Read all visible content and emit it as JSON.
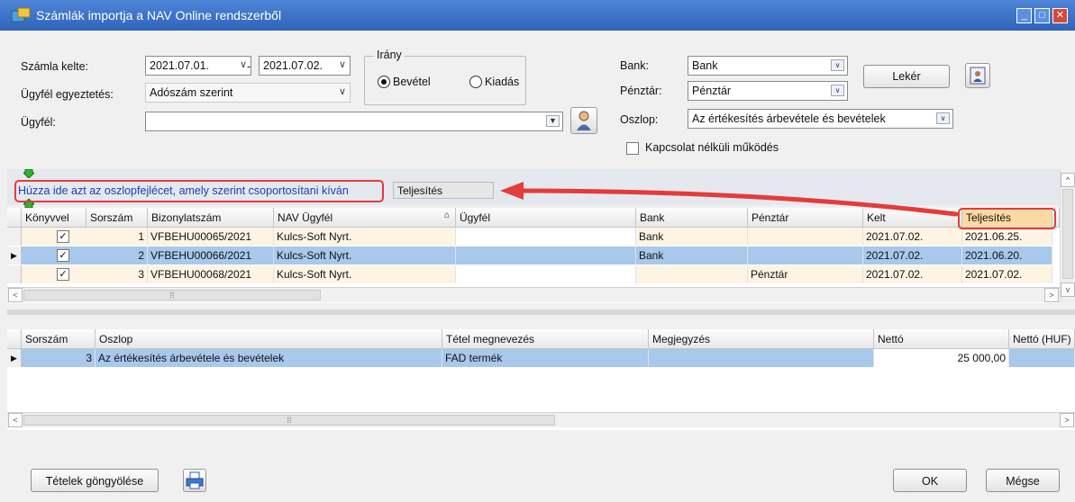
{
  "window": {
    "title": "Számlák importja a NAV Online rendszerből",
    "controls": [
      "minimize-icon",
      "maximize-icon",
      "close-icon"
    ]
  },
  "filters": {
    "invoice_date_label": "Számla kelte:",
    "date_from": "2021.07.01.",
    "date_sep": "-",
    "date_to": "2021.07.02.",
    "client_match_label": "Ügyfél egyeztetés:",
    "client_match_value": "Adószám szerint",
    "client_label": "Ügyfél:",
    "client_value": "",
    "direction_legend": "Irány",
    "direction_income": "Bevétel",
    "direction_expense": "Kiadás",
    "direction_selected": "Bevétel",
    "bank_label": "Bank:",
    "bank_value": "Bank",
    "cash_label": "Pénztár:",
    "cash_value": "Pénztár",
    "column_label": "Oszlop:",
    "column_value": "Az értékesítés árbevétele és bevételek",
    "offline_label": "Kapcsolat nélküli működés",
    "offline_checked": false,
    "fetch_button": "Lekér"
  },
  "grouping": {
    "hint": "Húzza ide azt az oszlopfejlécet, amely szerint csoportosítani kíván",
    "dragged_column": "Teljesítés"
  },
  "invoices_grid": {
    "columns": [
      "Könyvvel",
      "Sorszám",
      "Bizonylatszám",
      "NAV Ügyfél",
      "Ügyfél",
      "Bank",
      "Pénztár",
      "Kelt",
      "Teljesítés"
    ],
    "rows": [
      {
        "checked": true,
        "no": "1",
        "doc": "VFBEHU00065/2021",
        "nav_client": "Kulcs-Soft Nyrt.",
        "client": "",
        "bank": "Bank",
        "cash": "",
        "date": "2021.07.02.",
        "fulfil": "2021.06.25.",
        "selected": false
      },
      {
        "checked": true,
        "no": "2",
        "doc": "VFBEHU00066/2021",
        "nav_client": "Kulcs-Soft Nyrt.",
        "client": "",
        "bank": "Bank",
        "cash": "",
        "date": "2021.07.02.",
        "fulfil": "2021.06.20.",
        "selected": true
      },
      {
        "checked": true,
        "no": "3",
        "doc": "VFBEHU00068/2021",
        "nav_client": "Kulcs-Soft Nyrt.",
        "client": "",
        "bank": "",
        "cash": "Pénztár",
        "date": "2021.07.02.",
        "fulfil": "2021.07.02.",
        "selected": false
      }
    ]
  },
  "items_grid": {
    "columns": [
      "Sorszám",
      "Oszlop",
      "Tétel megnevezés",
      "Megjegyzés",
      "Nettó",
      "Nettó (HUF)"
    ],
    "rows": [
      {
        "no": "3",
        "column": "Az értékesítés árbevétele és bevételek",
        "item": "FAD termék",
        "note": "",
        "net": "25 000,00",
        "net_huf": ""
      }
    ]
  },
  "footer": {
    "collapse_button": "Tételek göngyölése",
    "ok_button": "OK",
    "cancel_button": "Mégse"
  },
  "colors": {
    "title_bar": "#3a6fc4",
    "selected_row": "#a8c8ec",
    "row_alt": "#fdf4e3",
    "highlight": "#e43b3b",
    "hint_text": "#1a3fae"
  }
}
